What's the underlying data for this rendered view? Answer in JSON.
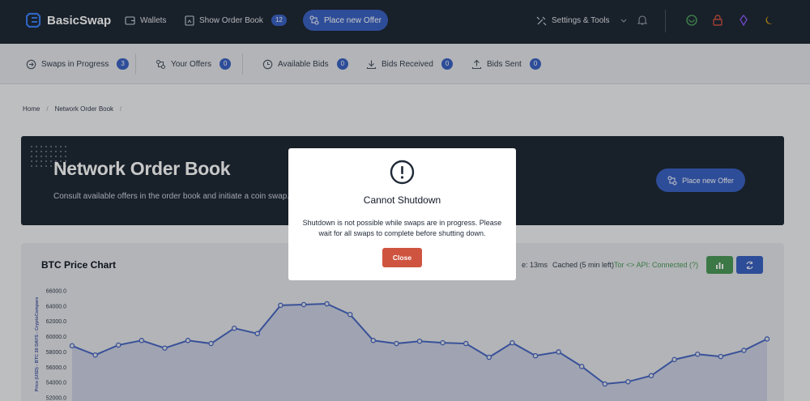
{
  "app": {
    "name": "BasicSwap"
  },
  "topnav": {
    "wallets": "Wallets",
    "show_order_book": "Show Order Book",
    "order_book_count": "12",
    "place_new_offer": "Place new Offer",
    "settings_tools": "Settings & Tools"
  },
  "subnav": {
    "swaps_in_progress": {
      "label": "Swaps in Progress",
      "count": "3"
    },
    "your_offers": {
      "label": "Your Offers",
      "count": "0"
    },
    "available_bids": {
      "label": "Available Bids",
      "count": "0"
    },
    "bids_received": {
      "label": "Bids Received",
      "count": "0"
    },
    "bids_sent": {
      "label": "Bids Sent",
      "count": "0"
    }
  },
  "breadcrumb": {
    "home": "Home",
    "current": "Network Order Book"
  },
  "hero": {
    "title": "Network Order Book",
    "subtitle": "Consult available offers in the order book and initiate a coin swap.",
    "button": "Place new Offer"
  },
  "chart": {
    "title": "BTC Price Chart",
    "load_time": "e: 13ms",
    "cache_status": "Cached (5 min left)",
    "tor_status": "Tor <> API: Connected (?)"
  },
  "modal": {
    "title": "Cannot Shutdown",
    "message": "Shutdown is not possible while swaps are in progress. Please wait for all swaps to complete before shutting down.",
    "close": "Close"
  },
  "colors": {
    "nav_bg": "#1f2937",
    "accent": "#3b63c4",
    "success": "#4c9a5a",
    "danger": "#cf5440"
  },
  "chart_data": {
    "type": "line",
    "ylabel": "Price (USD) - BTC 30 DAYS - CryptoCompare",
    "ylim": [
      52000,
      66000
    ],
    "yticks": [
      "66000.0",
      "64000.0",
      "62000.0",
      "60000.0",
      "58000.0",
      "56000.0",
      "54000.0",
      "52000.0"
    ],
    "series": [
      {
        "values": [
          58800,
          57600,
          58900,
          59500,
          58500,
          59500,
          59100,
          61100,
          60400,
          64100,
          64200,
          64300,
          62900,
          59500,
          59100,
          59400,
          59200,
          59100,
          57300,
          59200,
          57500,
          58000,
          56100,
          53800,
          54100,
          54900,
          57000,
          57700,
          57400,
          58200,
          59700
        ]
      }
    ]
  }
}
